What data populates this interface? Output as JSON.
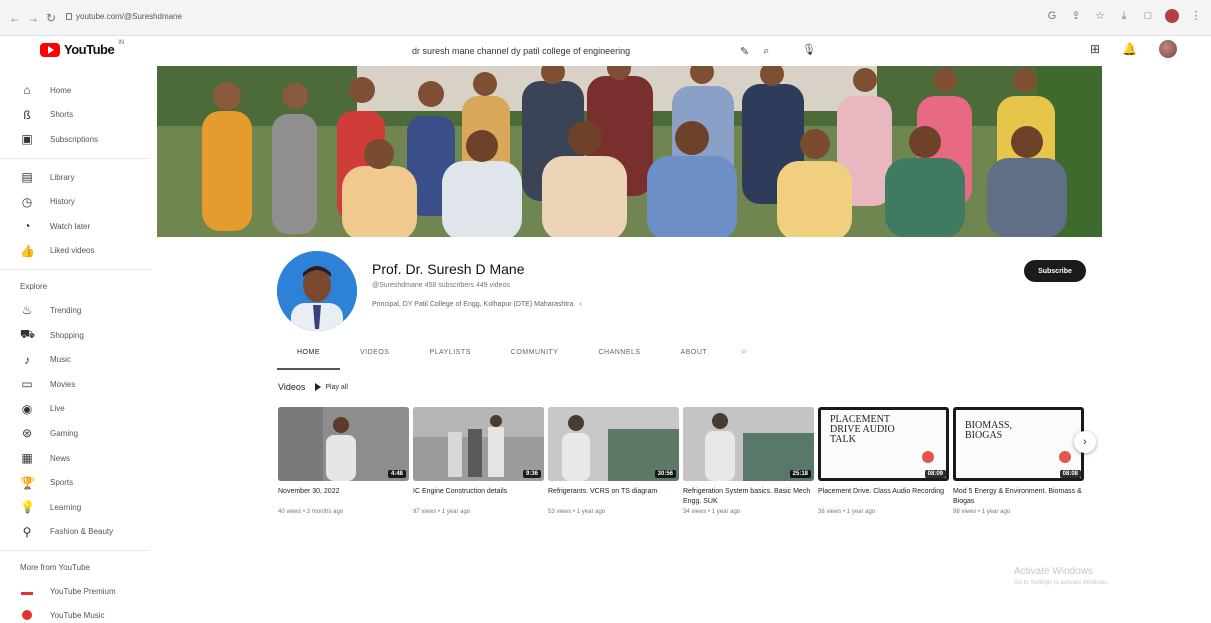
{
  "browser": {
    "url": "youtube.com/@Sureshdmane"
  },
  "header": {
    "logo_text": "YouTube",
    "logo_region": "IN",
    "search_value": "dr suresh mane channel dy patil college of engineering"
  },
  "sidebar": {
    "main": [
      {
        "label": "Home",
        "icon": "home-icon"
      },
      {
        "label": "Shorts",
        "icon": "shorts-icon"
      },
      {
        "label": "Subscriptions",
        "icon": "subscriptions-icon"
      }
    ],
    "library": [
      {
        "label": "Library",
        "icon": "library-icon"
      },
      {
        "label": "History",
        "icon": "history-icon"
      },
      {
        "label": "Watch later",
        "icon": "watch-later-icon"
      },
      {
        "label": "Liked videos",
        "icon": "liked-videos-icon"
      }
    ],
    "explore_heading": "Explore",
    "explore": [
      {
        "label": "Trending",
        "icon": "trending-icon"
      },
      {
        "label": "Shopping",
        "icon": "shopping-icon"
      },
      {
        "label": "Music",
        "icon": "music-icon"
      },
      {
        "label": "Movies",
        "icon": "movies-icon"
      },
      {
        "label": "Live",
        "icon": "live-icon"
      },
      {
        "label": "Gaming",
        "icon": "gaming-icon"
      },
      {
        "label": "News",
        "icon": "news-icon"
      },
      {
        "label": "Sports",
        "icon": "sports-icon"
      },
      {
        "label": "Learning",
        "icon": "learning-icon"
      },
      {
        "label": "Fashion & Beauty",
        "icon": "fashion-icon"
      }
    ],
    "more_heading": "More from YouTube",
    "more": [
      {
        "label": "YouTube Premium",
        "icon": "youtube-premium-icon"
      },
      {
        "label": "YouTube Music",
        "icon": "youtube-music-icon"
      }
    ]
  },
  "channel": {
    "name": "Prof. Dr. Suresh D Mane",
    "meta": "@Sureshdmane  458 subscribers  449 videos",
    "description": "Principal, DY Patil College of Engg, Kolhapur (DTE) Maharashtra",
    "subscribe_label": "Subscribe"
  },
  "tabs": [
    "HOME",
    "VIDEOS",
    "PLAYLISTS",
    "COMMUNITY",
    "CHANNELS",
    "ABOUT"
  ],
  "videos_section": {
    "title": "Videos",
    "play_all": "Play all"
  },
  "videos": [
    {
      "title": "November 30, 2022",
      "meta": "40 views • 3 months ago",
      "duration": "4:48"
    },
    {
      "title": "IC Engine Construction details",
      "meta": "97 views • 1 year ago",
      "duration": "9:36"
    },
    {
      "title": "Refrigerants. VCRS on TS diagram",
      "meta": "53 views • 1 year ago",
      "duration": "30:56"
    },
    {
      "title": "Refrigeration System basics. Basic Mech Engg. SUK",
      "meta": "34 views • 1 year ago",
      "duration": "25:18"
    },
    {
      "title": "Placement Drive. Class Audio Recording",
      "meta": "38 views • 1 year ago",
      "duration": "08:09",
      "thumb_text": "PLACEMENT DRIVE AUDIO TALK"
    },
    {
      "title": "Mod 5 Energy & Environment. Biomass & Biogas",
      "meta": "98 views • 1 year ago",
      "duration": "08:08",
      "thumb_text": "BIOMASS, BIOGAS"
    }
  ],
  "watermark": {
    "line1": "Activate Windows",
    "line2": "Go to Settings to activate Windows."
  },
  "colors": {
    "brand_red": "#ff0000",
    "subscribe_bg": "#1b1b1b",
    "avatar_bg": "#2d82d8"
  }
}
